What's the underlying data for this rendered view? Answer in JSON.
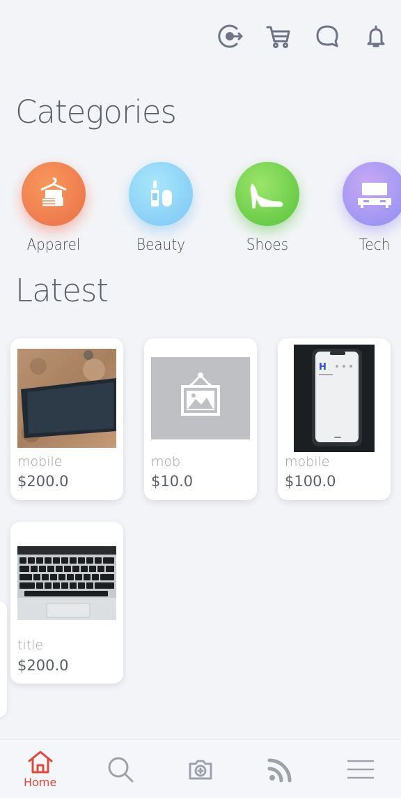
{
  "header": {
    "icons": [
      "login-icon",
      "cart-icon",
      "chat-icon",
      "bell-icon"
    ]
  },
  "categories": {
    "title": "Categories",
    "items": [
      {
        "label": "Apparel",
        "icon": "hanger-shirt-icon",
        "color": "#ef7b4f"
      },
      {
        "label": "Beauty",
        "icon": "cosmetics-icon",
        "color": "#8fd3f7"
      },
      {
        "label": "Shoes",
        "icon": "high-heel-icon",
        "color": "#6fd14a"
      },
      {
        "label": "Tech",
        "icon": "tv-icon",
        "color": "#a59cf3"
      }
    ]
  },
  "latest": {
    "title": "Latest",
    "products": [
      {
        "title": "mobile",
        "price": "$200.0",
        "image": "phone-on-rock-photo"
      },
      {
        "title": "mob",
        "price": "$10.0",
        "image": "image-placeholder-icon"
      },
      {
        "title": "mobile",
        "price": "$100.0",
        "image": "phone-screen-photo"
      },
      {
        "title": "title",
        "price": "$200.0",
        "image": "laptop-keyboard-photo"
      }
    ]
  },
  "bottom_nav": {
    "items": [
      {
        "label": "Home",
        "icon": "home-icon",
        "active": true
      },
      {
        "label": "",
        "icon": "search-icon",
        "active": false
      },
      {
        "label": "",
        "icon": "camera-icon",
        "active": false
      },
      {
        "label": "",
        "icon": "feed-icon",
        "active": false
      },
      {
        "label": "",
        "icon": "menu-icon",
        "active": false
      }
    ],
    "accent": "#e0483a"
  }
}
